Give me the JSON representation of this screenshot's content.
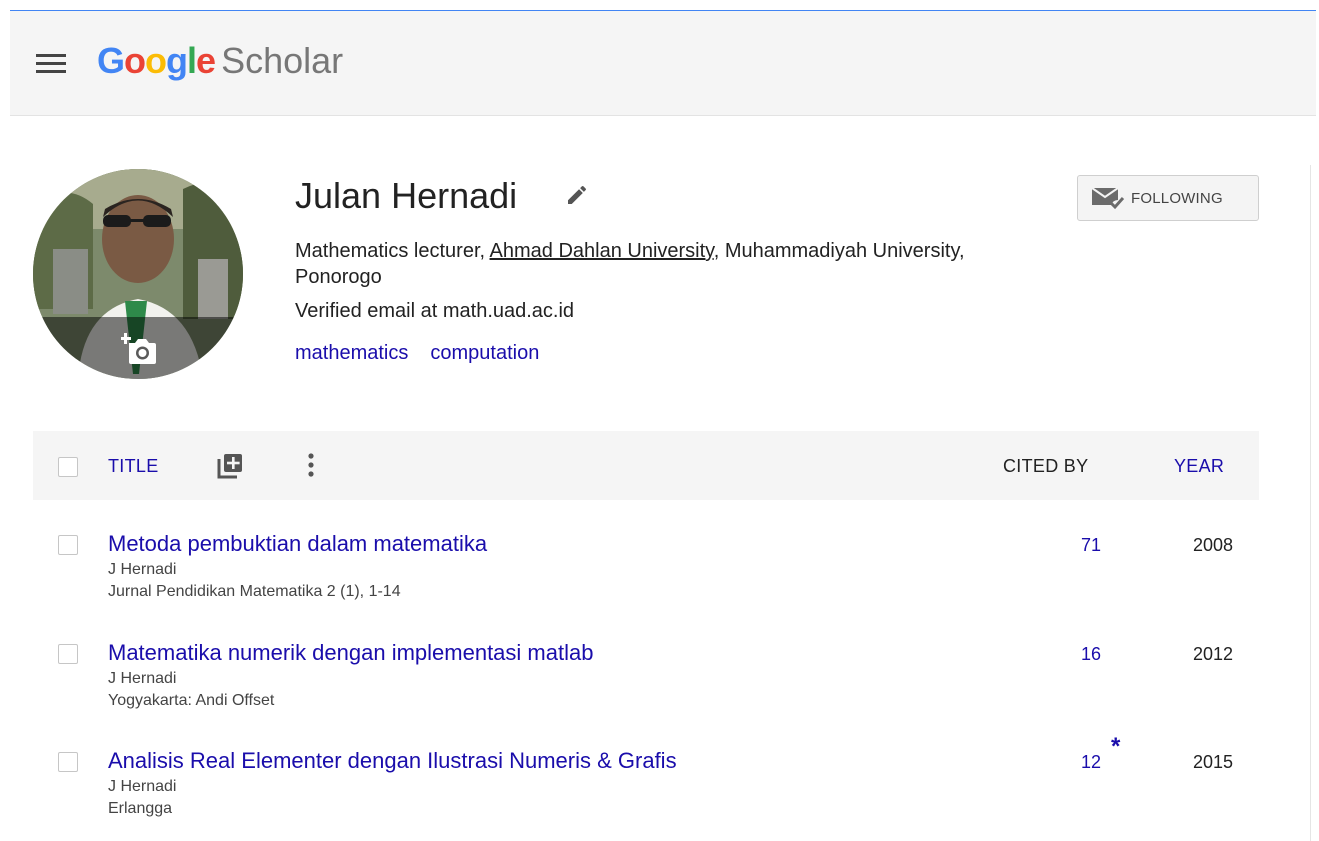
{
  "header": {
    "logo_google": [
      "G",
      "o",
      "o",
      "g",
      "l",
      "e"
    ],
    "logo_colors": [
      "#4285f4",
      "#ea4335",
      "#fbbc05",
      "#4285f4",
      "#34a853",
      "#ea4335"
    ],
    "logo_product": "Scholar"
  },
  "profile": {
    "name": "Julan Hernadi",
    "affiliation_prefix": "Mathematics lecturer, ",
    "affiliation_link": "Ahmad Dahlan University",
    "affiliation_suffix": ", Muhammadiyah University, Ponorogo",
    "email": "Verified email at math.uad.ac.id",
    "interests": [
      "mathematics",
      "computation"
    ],
    "follow_label": "FOLLOWING",
    "icons": {
      "edit": "pencil-icon",
      "photo": "add-photo-icon",
      "follow": "mail-check-icon"
    }
  },
  "table": {
    "header": {
      "title": "TITLE",
      "cited_by": "CITED BY",
      "year": "YEAR"
    },
    "rows": [
      {
        "title": "Metoda pembuktian dalam matematika",
        "author": "J Hernadi",
        "venue": "Jurnal Pendidikan Matematika 2 (1), 1-14",
        "cited": "71",
        "star": "",
        "year": "2008"
      },
      {
        "title": "Matematika numerik dengan implementasi matlab",
        "author": "J Hernadi",
        "venue": "Yogyakarta: Andi Offset",
        "cited": "16",
        "star": "",
        "year": "2012"
      },
      {
        "title": "Analisis Real Elementer dengan Ilustrasi Numeris & Grafis",
        "author": "J Hernadi",
        "venue": "Erlangga",
        "cited": "12",
        "star": "*",
        "year": "2015"
      }
    ]
  },
  "colors": {
    "link": "#1a0dab",
    "header_bg": "#f5f5f5",
    "accent_line": "#4285f4"
  }
}
